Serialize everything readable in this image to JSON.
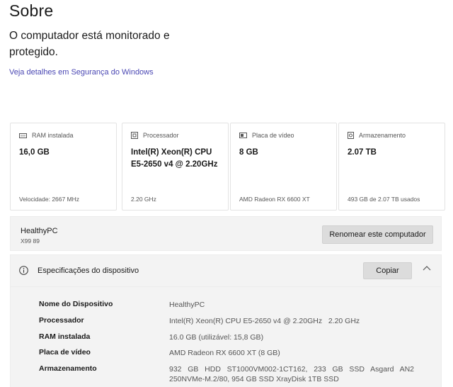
{
  "header": {
    "title": "Sobre",
    "status": "O computador está monitorado e protegido.",
    "link": "Veja detalhes em Segurança do Windows"
  },
  "cards": [
    {
      "icon": "ram-icon",
      "label": "RAM instalada",
      "value": "16,0 GB",
      "footer": "Velocidade: 2667 MHz"
    },
    {
      "icon": "processor-icon",
      "label": "Processador",
      "value": "Intel(R) Xeon(R) CPU E5-2650 v4 @ 2.20GHz",
      "footer": "2.20 GHz"
    },
    {
      "icon": "gpu-icon",
      "label": "Placa de vídeo",
      "value": "8 GB",
      "footer": "AMD Radeon RX 6600 XT"
    },
    {
      "icon": "storage-icon",
      "label": "Armazenamento",
      "value": "2.07 TB",
      "footer": "493 GB de 2.07 TB usados"
    }
  ],
  "pc": {
    "name": "HealthyPC",
    "model": "X99 89",
    "rename_label": "Renomear este computador"
  },
  "specs": {
    "title": "Especificações do dispositivo",
    "copy_label": "Copiar",
    "rows": [
      {
        "key": "Nome do Dispositivo",
        "value": "HealthyPC"
      },
      {
        "key": "Processador",
        "value": "Intel(R) Xeon(R) CPU E5-2650 v4 @ 2.20GHz   2.20 GHz"
      },
      {
        "key": "RAM instalada",
        "value": "16.0 GB (utilizável: 15,8 GB)"
      },
      {
        "key": "Placa de vídeo",
        "value": "AMD Radeon RX 6600 XT (8 GB)"
      },
      {
        "key": "Armazenamento",
        "value": "932 GB HDD ST1000VM002-1CT162, 233 GB SSD Asgard AN2 250NVMe-M.2/80, 954 GB SSD XrayDisk 1TB SSD"
      }
    ]
  }
}
